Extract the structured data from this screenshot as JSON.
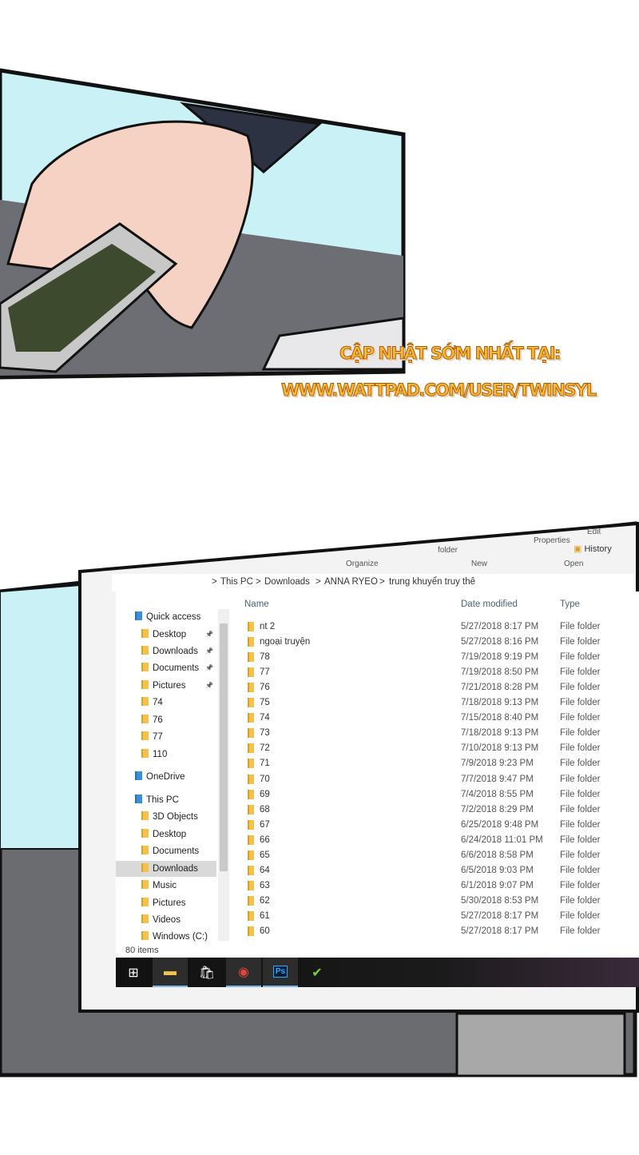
{
  "watermark": {
    "line1": "CẬP NHẬT SỚM NHẤT TẠI:",
    "line2": "WWW.WATTPAD.COM/USER/TWINSYL"
  },
  "ribbon": {
    "edit": "Edit",
    "properties": "Properties",
    "history": "History",
    "folder": "folder",
    "groups": [
      "Organize",
      "New",
      "Open"
    ]
  },
  "breadcrumb": {
    "items": [
      "This PC",
      "Downloads",
      "ANNA RYEO",
      "trung khuyển truy thê"
    ],
    "separator": ">"
  },
  "columns": {
    "name": "Name",
    "date": "Date modified",
    "type": "Type"
  },
  "nav": [
    {
      "label": "Quick access",
      "icon": "star-icon"
    },
    {
      "label": "Desktop",
      "icon": "desktop-folder-icon",
      "pinned": true
    },
    {
      "label": "Downloads",
      "icon": "downloads-folder-icon",
      "pinned": true
    },
    {
      "label": "Documents",
      "icon": "documents-folder-icon",
      "pinned": true
    },
    {
      "label": "Pictures",
      "icon": "pictures-folder-icon",
      "pinned": true
    },
    {
      "label": "74",
      "icon": "folder-icon"
    },
    {
      "label": "76",
      "icon": "folder-icon"
    },
    {
      "label": "77",
      "icon": "folder-icon"
    },
    {
      "label": "110",
      "icon": "folder-icon"
    },
    {
      "label": "OneDrive",
      "icon": "cloud-icon"
    },
    {
      "label": "This PC",
      "icon": "computer-icon"
    },
    {
      "label": "3D Objects",
      "icon": "3d-objects-icon"
    },
    {
      "label": "Desktop",
      "icon": "desktop-folder-icon"
    },
    {
      "label": "Documents",
      "icon": "documents-folder-icon"
    },
    {
      "label": "Downloads",
      "icon": "downloads-folder-icon",
      "selected": true
    },
    {
      "label": "Music",
      "icon": "music-icon"
    },
    {
      "label": "Pictures",
      "icon": "pictures-folder-icon"
    },
    {
      "label": "Videos",
      "icon": "videos-icon"
    },
    {
      "label": "Windows (C:)",
      "icon": "drive-icon"
    }
  ],
  "files": [
    {
      "name": "nt 2",
      "date": "5/27/2018 8:17 PM",
      "type": "File folder"
    },
    {
      "name": "ngoại truyện",
      "date": "5/27/2018 8:16 PM",
      "type": "File folder"
    },
    {
      "name": "78",
      "date": "7/19/2018 9:19 PM",
      "type": "File folder"
    },
    {
      "name": "77",
      "date": "7/19/2018 8:50 PM",
      "type": "File folder"
    },
    {
      "name": "76",
      "date": "7/21/2018 8:28 PM",
      "type": "File folder"
    },
    {
      "name": "75",
      "date": "7/18/2018 9:13 PM",
      "type": "File folder"
    },
    {
      "name": "74",
      "date": "7/15/2018 8:40 PM",
      "type": "File folder"
    },
    {
      "name": "73",
      "date": "7/18/2018 9:13 PM",
      "type": "File folder"
    },
    {
      "name": "72",
      "date": "7/10/2018 9:13 PM",
      "type": "File folder"
    },
    {
      "name": "71",
      "date": "7/9/2018 9:23 PM",
      "type": "File folder"
    },
    {
      "name": "70",
      "date": "7/7/2018 9:47 PM",
      "type": "File folder"
    },
    {
      "name": "69",
      "date": "7/4/2018 8:55 PM",
      "type": "File folder"
    },
    {
      "name": "68",
      "date": "7/2/2018 8:29 PM",
      "type": "File folder"
    },
    {
      "name": "67",
      "date": "6/25/2018 9:48 PM",
      "type": "File folder"
    },
    {
      "name": "66",
      "date": "6/24/2018 11:01 PM",
      "type": "File folder"
    },
    {
      "name": "65",
      "date": "6/6/2018 8:58 PM",
      "type": "File folder"
    },
    {
      "name": "64",
      "date": "6/5/2018 9:03 PM",
      "type": "File folder"
    },
    {
      "name": "63",
      "date": "6/1/2018 9:07 PM",
      "type": "File folder"
    },
    {
      "name": "62",
      "date": "5/30/2018 8:53 PM",
      "type": "File folder"
    },
    {
      "name": "61",
      "date": "5/27/2018 8:17 PM",
      "type": "File folder"
    },
    {
      "name": "60",
      "date": "5/27/2018 8:17 PM",
      "type": "File folder"
    }
  ],
  "status": "80 items",
  "taskbar": [
    {
      "icon": "windows-start-icon",
      "glyph": "⊞"
    },
    {
      "icon": "file-explorer-icon",
      "glyph": "▬",
      "active": true
    },
    {
      "icon": "store-icon",
      "glyph": "🛍"
    },
    {
      "icon": "chrome-icon",
      "glyph": "◉",
      "active": true
    },
    {
      "icon": "photoshop-icon",
      "glyph": "Ps",
      "active": true
    },
    {
      "icon": "checkmark-app-icon",
      "glyph": "✔"
    }
  ]
}
